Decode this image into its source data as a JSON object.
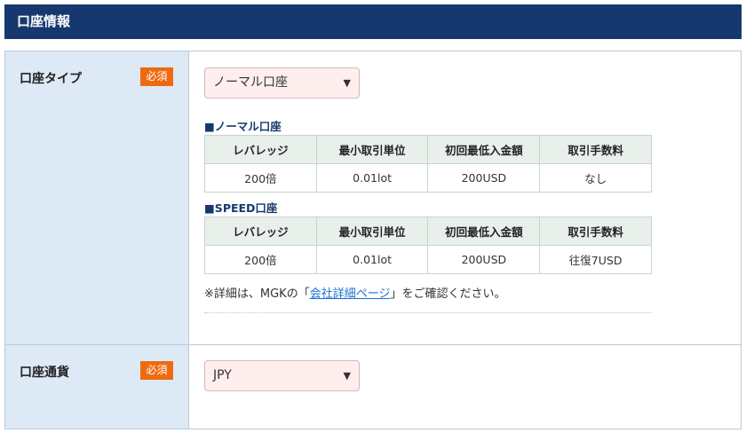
{
  "header": {
    "title": "口座情報"
  },
  "account_type": {
    "label": "口座タイプ",
    "required_badge": "必須",
    "selected": "ノーマル口座"
  },
  "normal_table": {
    "title": "■ノーマル口座",
    "headers": [
      "レバレッジ",
      "最小取引単位",
      "初回最低入金額",
      "取引手数料"
    ],
    "values": [
      "200倍",
      "0.01lot",
      "200USD",
      "なし"
    ]
  },
  "speed_table": {
    "title": "■SPEED口座",
    "headers": [
      "レバレッジ",
      "最小取引単位",
      "初回最低入金額",
      "取引手数料"
    ],
    "values": [
      "200倍",
      "0.01lot",
      "200USD",
      "往復7USD"
    ]
  },
  "note": {
    "prefix": "※詳細は、MGKの「",
    "link": "会社詳細ページ",
    "suffix": "」をご確認ください。"
  },
  "currency": {
    "label": "口座通貨",
    "required_badge": "必須",
    "selected": "JPY"
  },
  "colors": {
    "header_bg": "#17386e",
    "badge": "#ee6a11",
    "label_bg": "#dde9f5",
    "select_bg": "#ffeeee"
  }
}
